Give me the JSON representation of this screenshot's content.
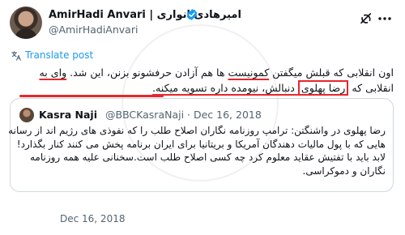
{
  "author": {
    "name": "AmirHadi Anvari | امیرهادی انواری",
    "handle": "@AmirHadiAnvari",
    "avatar_icon": "user-avatar"
  },
  "actions": {
    "grok_icon": "grok-icon",
    "more_icon": "more-horizontal-icon"
  },
  "translate": {
    "label": "Translate post",
    "icon": "translate-icon"
  },
  "tweet": {
    "line1_a": "اون انقلابی که قبلش میگفتن ",
    "line1_u1": "کمونیست",
    "line1_b": " ها هم آزادن حرفشونو بزنن، این شد. ",
    "line1_u2": "وای به",
    "line2_a": "انقلابی که ",
    "line2_box": "رضا پهلوی",
    "line2_b": " دنبالش، نیومده داره تسویه میکنه."
  },
  "quoted": {
    "name": "Kasra Naji",
    "meta": "@BBCKasraNaji · Dec 16, 2018",
    "text_lines": [
      "رضا پهلوی در واشنگتن: ترامپ روزنامه نگاران اصلاح طلب را که نفوذی های رژیم اند از رسانه",
      "هایی که با پول مالیات دهندگان آمریکا و بریتانیا برای ایران برنامه پخش می کنند کنار بگذارد!",
      "لابد باید با تفتیش عقاید معلوم کرد چه کسی اصلاح طلب است.سخنانی علیه همه روزنامه",
      "نگاران و دموکراسی."
    ]
  },
  "date": "Dec 16, 2018",
  "colors": {
    "accent": "#1d9bf0",
    "highlight": "#e8262b",
    "muted": "#536471",
    "text": "#0f1419",
    "border": "#cfd9de"
  }
}
